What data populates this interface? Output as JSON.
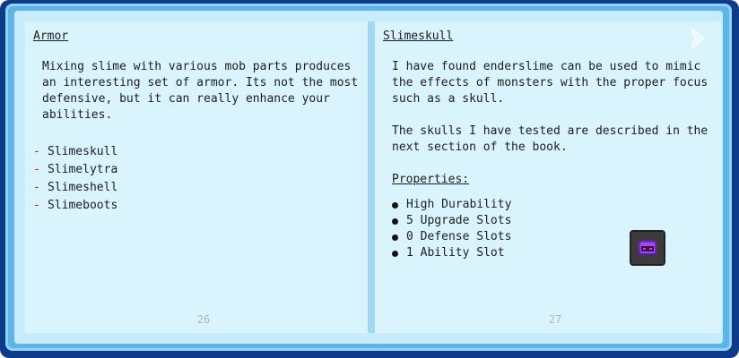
{
  "left_page": {
    "title": "Armor",
    "intro": "Mixing slime with various mob parts produces an interesting set of armor. Its not the most defensive, but it can really enhance your abilities.",
    "items": [
      "Slimeskull",
      "Slimelytra",
      "Slimeshell",
      "Slimeboots"
    ],
    "page_number": "26"
  },
  "right_page": {
    "title": "Slimeskull",
    "paragraph1": "I have found enderslime can be used to mimic the effects of monsters with the proper focus such as a skull.",
    "paragraph2": "The skulls I have tested are described in the next section of the book.",
    "properties_title": "Properties:",
    "properties": [
      "High Durability",
      "5 Upgrade Slots",
      "0 Defense Slots",
      "1 Ability Slot"
    ],
    "page_number": "27",
    "item_icon": "slimeskull-helmet-icon"
  },
  "colors": {
    "frame_outer": "#0e3a8a",
    "frame": "#5fb3e8",
    "page": "#daf4fd",
    "dash": "#c11a1a",
    "page_number": "#a6b6c2"
  }
}
